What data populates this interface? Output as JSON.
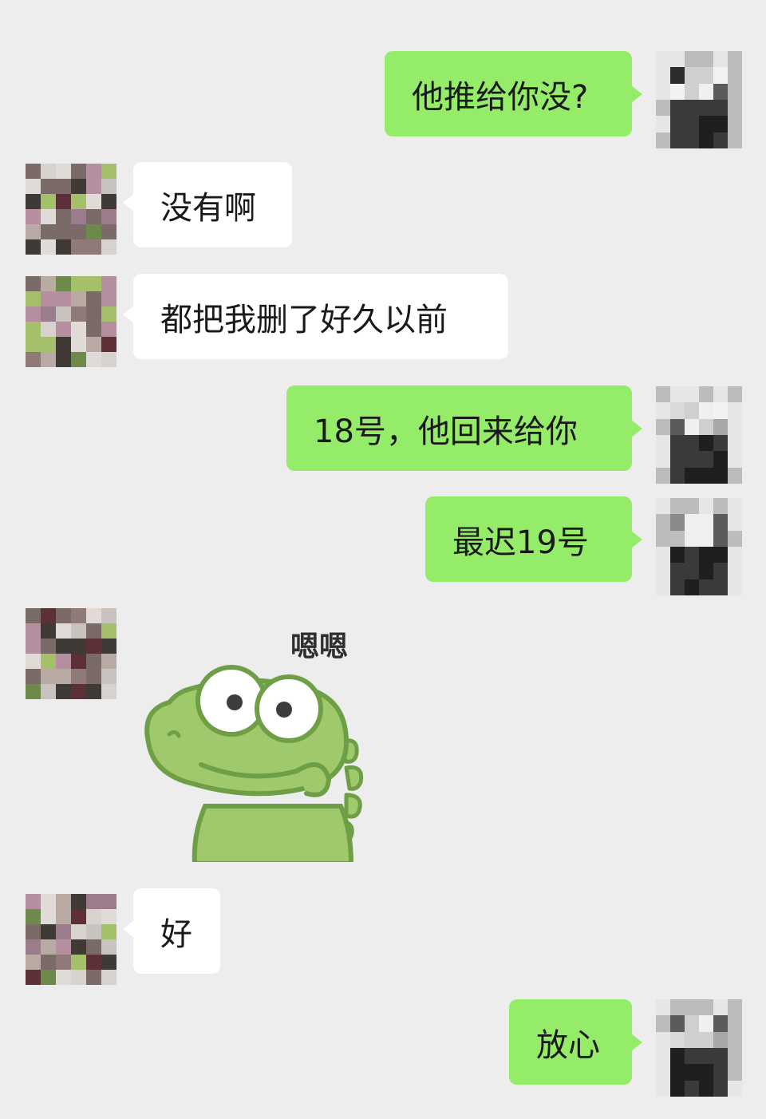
{
  "messages": [
    {
      "side": "out",
      "text": "他推给你没?"
    },
    {
      "side": "in",
      "text": "没有啊"
    },
    {
      "side": "in",
      "text": "都把我删了好久以前"
    },
    {
      "side": "out",
      "text": "18号，他回来给你"
    },
    {
      "side": "out",
      "text": "最迟19号"
    },
    {
      "side": "in",
      "sticker": "frog-sticker",
      "sticker_text": "嗯嗯"
    },
    {
      "side": "in",
      "text": "好"
    },
    {
      "side": "out",
      "text": "放心"
    }
  ],
  "colors": {
    "background": "#ededed",
    "outgoing_bubble": "#95ec69",
    "incoming_bubble": "#ffffff",
    "text": "#191919",
    "frog_body": "#9fc96a",
    "frog_outline": "#6e9e45"
  }
}
